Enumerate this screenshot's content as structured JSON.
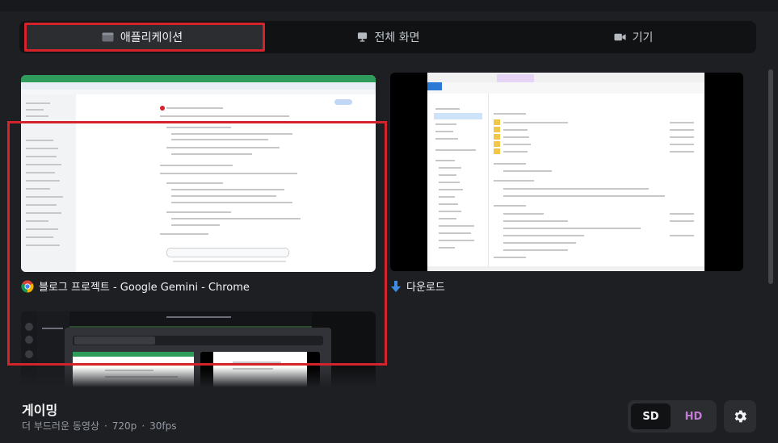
{
  "tabs": [
    {
      "label": "애플리케이션",
      "icon": "window-icon",
      "active": true
    },
    {
      "label": "전체 화면",
      "icon": "monitor-icon",
      "active": false
    },
    {
      "label": "기기",
      "icon": "camera-icon",
      "active": false
    }
  ],
  "sources": [
    {
      "label": "블로그 프로젝트 - Google Gemini - Chrome",
      "icon": "chrome-icon",
      "selected": true
    },
    {
      "label": "다운로드",
      "icon": "download-arrow-icon",
      "selected": false
    },
    {
      "label": "",
      "icon": "discord-window-thumbnail",
      "selected": false
    }
  ],
  "preset": {
    "title": "게이밍",
    "subtitle": "더 부드러운 동영상",
    "resolution": "720p",
    "framerate": "30fps"
  },
  "quality": {
    "sd": "SD",
    "hd": "HD",
    "selected": "SD"
  },
  "colors": {
    "selection": "#d4232b",
    "hd_accent": "#c47bd6"
  }
}
